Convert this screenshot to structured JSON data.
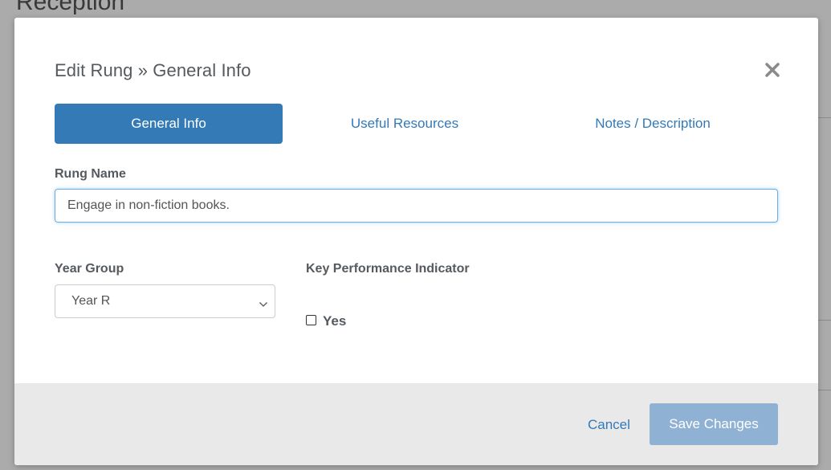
{
  "background": {
    "page_title": "Reception"
  },
  "modal": {
    "title": "Edit Rung » General Info",
    "close_icon": "close-icon",
    "tabs": [
      {
        "label": "General Info",
        "active": true
      },
      {
        "label": "Useful Resources",
        "active": false
      },
      {
        "label": "Notes / Description",
        "active": false
      }
    ],
    "rung_name": {
      "label": "Rung Name",
      "value": "Engage in non-fiction books."
    },
    "year_group": {
      "label": "Year Group",
      "selected": "Year R",
      "icon": "chevron-down-icon"
    },
    "kpi": {
      "label": "Key Performance Indicator",
      "checkbox_label": "Yes",
      "checked": false
    },
    "footer": {
      "cancel_label": "Cancel",
      "save_label": "Save Changes"
    }
  },
  "colors": {
    "accent": "#337ab7",
    "save_disabled": "#8fb1d3",
    "footer_bg": "#e9e9e9",
    "label_text": "#555a5f"
  }
}
